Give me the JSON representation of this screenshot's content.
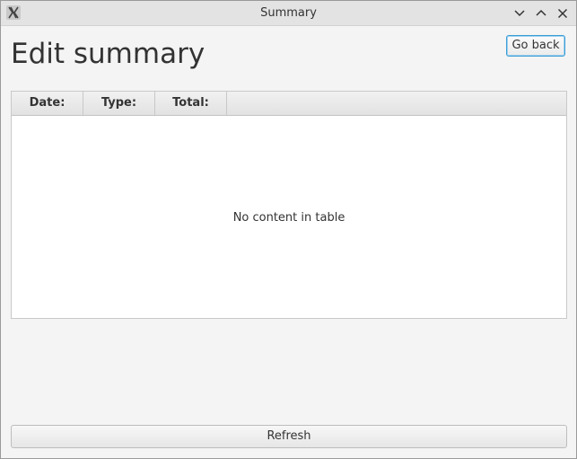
{
  "window": {
    "title": "Summary"
  },
  "page": {
    "heading": "Edit summary",
    "go_back_label": "Go back"
  },
  "table": {
    "columns": [
      "Date:",
      "Type:",
      "Total:"
    ],
    "rows": [],
    "empty_message": "No content in table"
  },
  "footer": {
    "refresh_label": "Refresh"
  },
  "icons": {
    "app": "x-app-icon",
    "minimize": "chevron-down-icon",
    "maximize": "chevron-up-icon",
    "close": "close-icon"
  },
  "colors": {
    "focus_border": "#3a9dd6",
    "window_bg": "#f4f4f4",
    "titlebar_bg": "#e3e3e3"
  }
}
